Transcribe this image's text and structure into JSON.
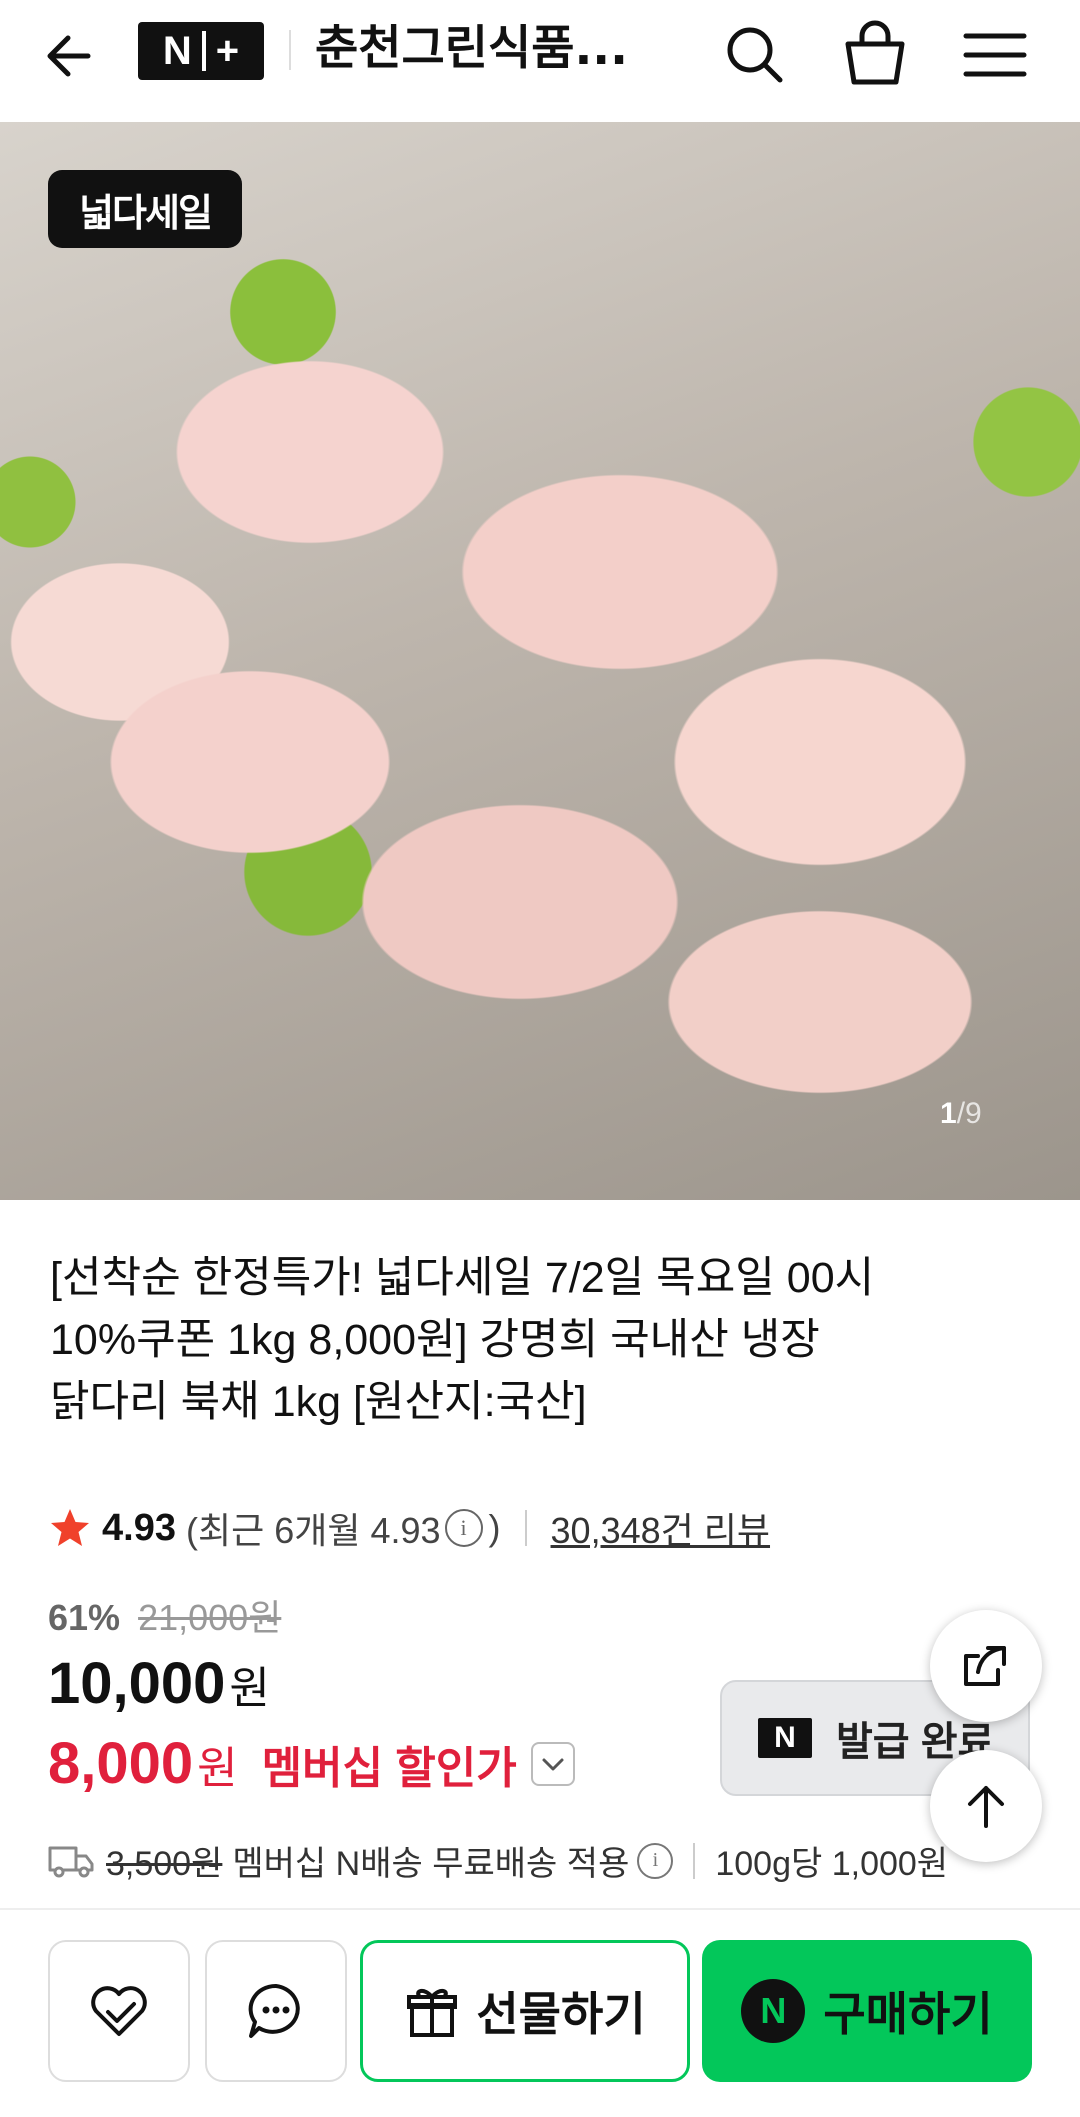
{
  "header": {
    "store_name": "춘천그린식품...",
    "logo_text": "N",
    "logo_plus": "+"
  },
  "gallery": {
    "badge": "넓다세일",
    "current": "1",
    "total": "/9"
  },
  "product": {
    "title_line1": "[선착순 한정특가! 넓다세일 7/2일 목요일 00시",
    "title_line2": "10%쿠폰 1kg 8,000원] 강명희 국내산 냉장",
    "title_line3": "닭다리 북채 1kg [원산지:국산]"
  },
  "rating": {
    "score": "4.93",
    "recent_label": "(최근 6개월 4.93",
    "recent_close": ")",
    "review_count": "30,348건 리뷰"
  },
  "pricing": {
    "discount_pct": "61%",
    "original_price": "21,000원",
    "sale_price": "10,000",
    "won": "원",
    "member_price": "8,000",
    "member_label": "멤버십 할인가",
    "coupon_n": "N",
    "coupon_status": "발급 완료"
  },
  "shipping": {
    "original_fee": "3,500원",
    "text": "멤버십 N배송 무료배송 적용",
    "unit_price": "100g당 1,000원"
  },
  "actions": {
    "gift_label": "선물하기",
    "buy_n": "N",
    "buy_label": "구매하기"
  },
  "colors": {
    "accent_green": "#03c75a",
    "member_red": "#e0203c",
    "star": "#f0412b"
  }
}
